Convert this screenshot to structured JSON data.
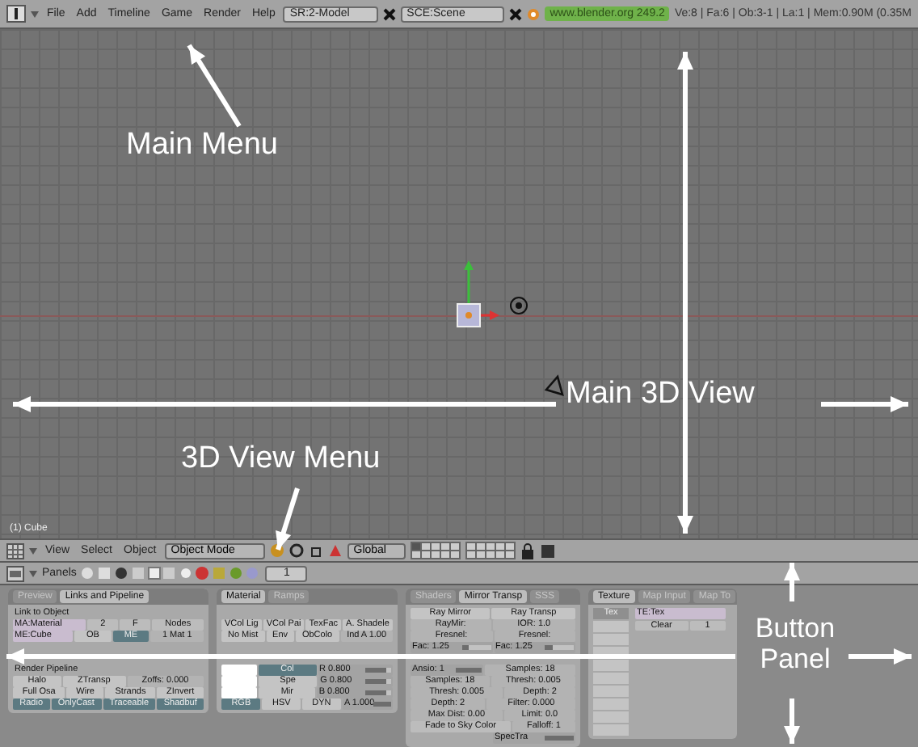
{
  "top_bar": {
    "menus": [
      "File",
      "Add",
      "Timeline",
      "Game",
      "Render",
      "Help"
    ],
    "screen": "SR:2-Model",
    "scene": "SCE:Scene",
    "version": "www.blender.org 249.2",
    "stats": "Ve:8 | Fa:6 | Ob:3-1 | La:1 | Mem:0.90M (0.35M"
  },
  "viewport": {
    "object_label": "(1) Cube"
  },
  "view3d_header": {
    "menus": [
      "View",
      "Select",
      "Object"
    ],
    "mode": "Object Mode",
    "orientation": "Global"
  },
  "buttons_header": {
    "label": "Panels",
    "page": "1"
  },
  "panels": [
    {
      "kind": "controls",
      "tabs": [
        {
          "label": "Preview",
          "selected": false
        },
        {
          "label": "Links and Pipeline",
          "selected": true
        }
      ],
      "rows": [
        [
          {
            "kind": "text",
            "label": "Link to Object"
          }
        ],
        [
          {
            "kind": "field",
            "label": "MA:Material"
          },
          {
            "kind": "button",
            "label": "2"
          },
          {
            "kind": "button",
            "label": "F"
          },
          {
            "kind": "button",
            "label": "Nodes"
          }
        ],
        [
          {
            "kind": "field",
            "label": "ME:Cube"
          },
          {
            "kind": "toggle",
            "label": "OB",
            "on": false
          },
          {
            "kind": "toggle",
            "label": "ME",
            "on": true
          },
          {
            "kind": "num",
            "label": "1 Mat 1"
          }
        ],
        [
          {
            "kind": "text",
            "label": "Render Pipeline"
          }
        ],
        [
          {
            "kind": "toggle",
            "label": "Halo",
            "on": false
          },
          {
            "kind": "toggle",
            "label": "ZTransp",
            "on": false
          },
          {
            "kind": "num",
            "label": "Zoffs: 0.000"
          }
        ],
        [
          {
            "kind": "toggle",
            "label": "Full Osa",
            "on": false
          },
          {
            "kind": "toggle",
            "label": "Wire",
            "on": false
          },
          {
            "kind": "toggle",
            "label": "Strands",
            "on": false
          },
          {
            "kind": "toggle",
            "label": "ZInvert",
            "on": false
          }
        ],
        [
          {
            "kind": "toggle",
            "label": "Radio",
            "on": true
          },
          {
            "kind": "toggle",
            "label": "OnlyCast",
            "on": true
          },
          {
            "kind": "toggle",
            "label": "Traceable",
            "on": true
          },
          {
            "kind": "toggle",
            "label": "Shadbuf",
            "on": true
          }
        ]
      ]
    },
    {
      "kind": "controls",
      "tabs": [
        {
          "label": "Material",
          "selected": true
        },
        {
          "label": "Ramps",
          "selected": false
        }
      ],
      "rows": [
        [
          {
            "kind": "toggle",
            "label": "VCol Lig",
            "on": false
          },
          {
            "kind": "toggle",
            "label": "VCol Pai",
            "on": false
          },
          {
            "kind": "toggle",
            "label": "TexFac",
            "on": false
          },
          {
            "kind": "toggle",
            "label": "A. Shadele",
            "on": false
          }
        ],
        [
          {
            "kind": "toggle",
            "label": "No Mist",
            "on": false
          },
          {
            "kind": "toggle",
            "label": "Env",
            "on": false
          },
          {
            "kind": "toggle",
            "label": "ObColo",
            "on": false
          },
          {
            "kind": "num",
            "label": "Ind A 1.00"
          }
        ],
        [
          {
            "kind": "swatch"
          },
          {
            "kind": "toggle",
            "label": "Col",
            "on": true
          },
          {
            "kind": "slider",
            "label": "R 0.800",
            "level": 0.8
          }
        ],
        [
          {
            "kind": "swatch"
          },
          {
            "kind": "toggle",
            "label": "Spe",
            "on": false
          },
          {
            "kind": "slider",
            "label": "G 0.800",
            "level": 0.8
          }
        ],
        [
          {
            "kind": "swatch"
          },
          {
            "kind": "toggle",
            "label": "Mir",
            "on": false
          },
          {
            "kind": "slider",
            "label": "B 0.800",
            "level": 0.8
          }
        ],
        [
          {
            "kind": "toggle",
            "label": "RGB",
            "on": true
          },
          {
            "kind": "toggle",
            "label": "HSV",
            "on": false
          },
          {
            "kind": "toggle",
            "label": "DYN",
            "on": false
          },
          {
            "kind": "slider",
            "label": "A 1.000",
            "level": 1
          }
        ]
      ]
    },
    {
      "kind": "controls",
      "tabs": [
        {
          "label": "Shaders",
          "selected": false
        },
        {
          "label": "Mirror Transp",
          "selected": true
        },
        {
          "label": "SSS",
          "selected": false
        }
      ],
      "rows": [
        [
          {
            "kind": "toggle",
            "label": "Ray Mirror",
            "on": false
          },
          {
            "kind": "toggle",
            "label": "Ray Transp",
            "on": false
          }
        ],
        [
          {
            "kind": "num",
            "label": "RayMir:"
          },
          {
            "kind": "num",
            "label": "IOR: 1.0"
          }
        ],
        [
          {
            "kind": "num",
            "label": "Fresnel:"
          },
          {
            "kind": "num",
            "label": "Fresnel:"
          }
        ],
        [
          {
            "kind": "slider",
            "label": "Fac: 1.25",
            "level": 0.25
          },
          {
            "kind": "slider",
            "label": "Fac: 1.25",
            "level": 0.25
          }
        ],
        [
          {
            "kind": "slider",
            "label": "Ansio: 1",
            "level": 1
          },
          {
            "kind": "num",
            "label": "Samples: 18"
          }
        ],
        [
          {
            "kind": "num",
            "label": "Samples: 18"
          },
          {
            "kind": "num",
            "label": "Thresh: 0.005"
          }
        ],
        [
          {
            "kind": "num",
            "label": "Thresh: 0.005"
          },
          {
            "kind": "num",
            "label": "Depth: 2"
          }
        ],
        [
          {
            "kind": "num",
            "label": "Depth: 2"
          },
          {
            "kind": "num",
            "label": "Filter: 0.000"
          }
        ],
        [
          {
            "kind": "num",
            "label": "Max Dist: 0.00"
          },
          {
            "kind": "num",
            "label": "Limit: 0.0"
          }
        ],
        [
          {
            "kind": "button",
            "label": "Fade to Sky Color"
          },
          {
            "kind": "num",
            "label": "Falloff: 1"
          }
        ],
        [
          {
            "kind": "slider",
            "label": "SpecTra",
            "level": 1
          }
        ]
      ]
    },
    {
      "kind": "texture",
      "tabs": [
        {
          "label": "Texture",
          "selected": true
        },
        {
          "label": "Map Input",
          "selected": false
        },
        {
          "label": "Map To",
          "selected": false
        }
      ],
      "slots": [
        {
          "label": "Tex",
          "selected": true
        },
        {
          "selected": false
        },
        {
          "selected": false
        },
        {
          "selected": false
        },
        {
          "selected": false
        },
        {
          "selected": false
        },
        {
          "selected": false
        },
        {
          "selected": false
        },
        {
          "selected": false
        },
        {
          "selected": false
        }
      ],
      "texture_name": "TE:Tex",
      "buttons": [
        "Clear",
        "1"
      ]
    }
  ],
  "annotations": [
    {
      "text": "Main Menu"
    },
    {
      "text": "Main 3D View"
    },
    {
      "text": "3D View Menu"
    },
    {
      "text": "Button Panel"
    }
  ]
}
